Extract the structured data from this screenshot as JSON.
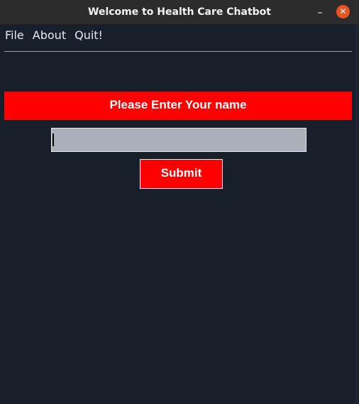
{
  "window": {
    "title": "Welcome to Health Care Chatbot",
    "minimize_glyph": "–",
    "close_glyph": "✕"
  },
  "menu": {
    "items": [
      "File",
      "About",
      "Quit!"
    ]
  },
  "form": {
    "prompt": "Please Enter Your name",
    "name_value": "",
    "submit_label": "Submit"
  },
  "colors": {
    "background": "#17202a",
    "accent_red": "#ff0000",
    "input_bg": "#aab0b8",
    "close_button": "#e95420"
  },
  "icons": {
    "minimize": "minimize-icon",
    "close": "close-icon"
  }
}
